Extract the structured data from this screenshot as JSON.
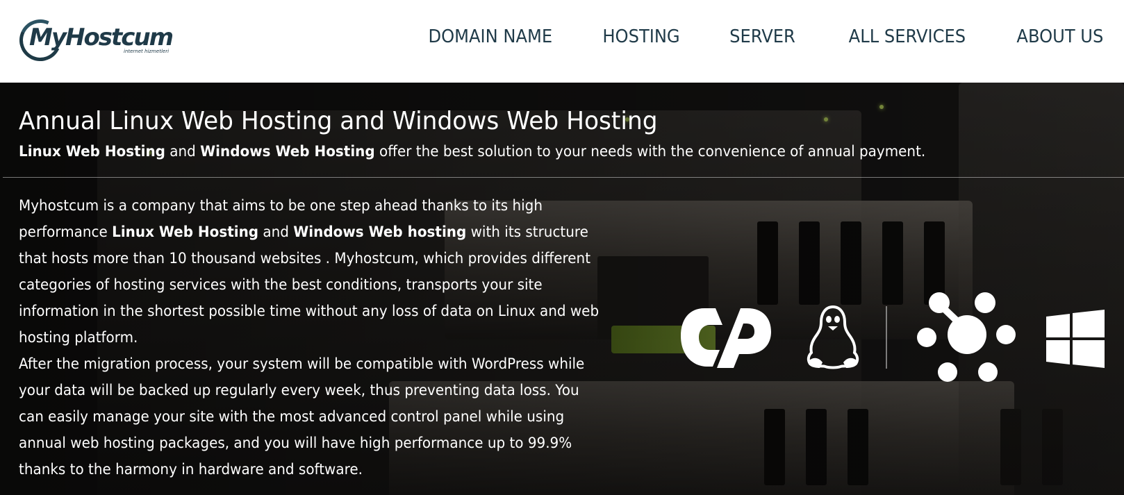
{
  "header": {
    "logo_text": "MyHostcum",
    "logo_subtext": "internet hizmetleri",
    "nav": [
      "DOMAIN NAME",
      "HOSTING",
      "SERVER",
      "ALL SERVICES",
      "ABOUT US"
    ]
  },
  "hero": {
    "title": "Annual Linux Web Hosting and Windows Web Hosting",
    "subtitle_bold_1": "Linux Web Hosting",
    "subtitle_mid": " and ",
    "subtitle_bold_2": "Windows Web Hosting",
    "subtitle_rest": " offer the best solution to your needs with the convenience of annual payment.",
    "p1_start": "Myhostcum is a company that aims to be one step ahead thanks to its high performance ",
    "p1_bold_1": "Linux Web Hosting",
    "p1_mid": " and ",
    "p1_bold_2": "Windows Web hosting",
    "p1_rest": " with its structure that hosts more than 10 thousand websites . Myhostcum, which provides different categories of hosting services with the best conditions, transports your site information in the shortest possible time without any loss of data on Linux and web hosting platform.",
    "p2": "After the migration process, your system will be compatible with WordPress while your data will be backed up regularly every week, thus preventing data loss. You can easily manage your site with the most advanced control panel while using annual web hosting packages, and you will have high performance up to 99.9% thanks to the harmony in hardware and software."
  },
  "icons": [
    "cpanel-icon",
    "linux-tux-icon",
    "plesk-network-icon",
    "windows-icon"
  ],
  "colors": {
    "nav_text": "#1f3a48",
    "hero_text": "#ffffff"
  }
}
